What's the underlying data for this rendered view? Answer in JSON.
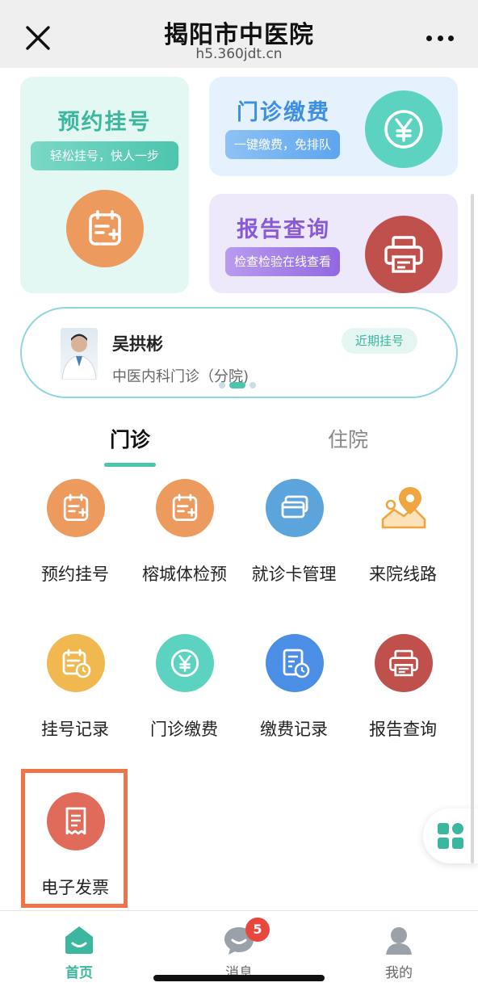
{
  "header": {
    "title": "揭阳市中医院",
    "subtitle": "h5.360jdt.cn",
    "close_icon": "close-icon",
    "more_icon": "more-icon"
  },
  "quick_cards": {
    "appointment": {
      "title": "预约挂号",
      "tag": "轻松挂号，快人一步",
      "icon": "calendar-plus-icon",
      "color": "#ec9a5e"
    },
    "payment": {
      "title": "门诊缴费",
      "tag": "一键缴费，免排队",
      "icon": "yen-icon",
      "color": "#5bd3c0"
    },
    "report": {
      "title": "报告查询",
      "tag": "检查检验在线查看",
      "icon": "printer-icon",
      "color": "#c0504b"
    }
  },
  "recent_doctor": {
    "name": "吴拱彬",
    "department": "中医内科门诊（分院)",
    "badge": "近期挂号"
  },
  "tabs": [
    {
      "label": "门诊",
      "active": true
    },
    {
      "label": "住院",
      "active": false
    }
  ],
  "services": [
    {
      "label": "预约挂号",
      "icon": "calendar-plus-icon",
      "color": "#ec9a5e"
    },
    {
      "label": "榕城体检预约",
      "icon": "calendar-plus-icon",
      "color": "#ec9a5e"
    },
    {
      "label": "就诊卡管理",
      "icon": "card-icon",
      "color": "#5ba4dc"
    },
    {
      "label": "来院线路",
      "icon": "map-pin-icon",
      "color": "#f0a640"
    },
    {
      "label": "挂号记录",
      "icon": "calendar-clock-icon",
      "color": "#f0b84e"
    },
    {
      "label": "门诊缴费",
      "icon": "yen-icon",
      "color": "#5bd3c0"
    },
    {
      "label": "缴费记录",
      "icon": "bill-clock-icon",
      "color": "#4a8ee6"
    },
    {
      "label": "报告查询",
      "icon": "printer-icon",
      "color": "#c0504b"
    },
    {
      "label": "电子发票",
      "icon": "receipt-icon",
      "color": "#e06b5a"
    }
  ],
  "floating_button": {
    "icon": "grid-apps-icon"
  },
  "bottom_nav": [
    {
      "label": "首页",
      "icon": "home-icon",
      "active": true
    },
    {
      "label": "消息",
      "icon": "message-icon",
      "badge": "5"
    },
    {
      "label": "我的",
      "icon": "user-icon"
    }
  ]
}
